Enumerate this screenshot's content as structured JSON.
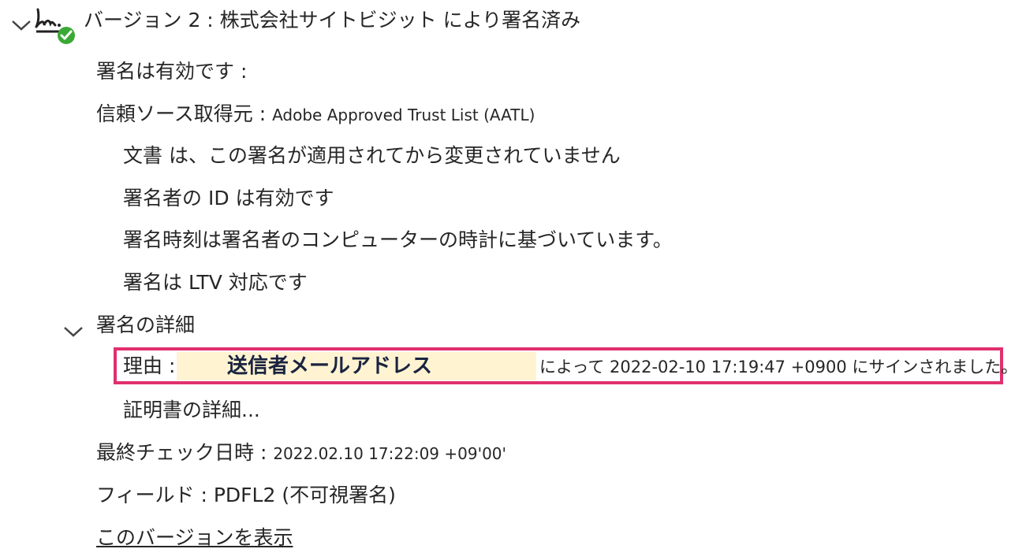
{
  "header": {
    "title": "バージョン 2 : 株式会社サイトビジット により署名済み",
    "expand_icon": "chevron-down-icon",
    "signature_icon": "signature-valid-icon",
    "status_color": "#3aa935"
  },
  "status": {
    "valid": "署名は有効です :",
    "trust_source_prefix": "信頼ソース取得元 : ",
    "trust_source_value": "Adobe Approved Trust List (AATL)",
    "items": [
      "文書 は、この署名が適用されてから変更されていません",
      "署名者の ID は有効です",
      "署名時刻は署名者のコンピューターの時計に基づいています。",
      "署名は LTV 対応です"
    ]
  },
  "details": {
    "label": "署名の詳細",
    "reason_label": "理由 :",
    "reason_value": "送信者メールアドレス",
    "reason_suffix": "によって 2022-02-10 17:19:47 +0900 にサインされました。",
    "certificate_link": "証明書の詳細...",
    "highlight_color": "#e0306e",
    "fill_color": "#fff3d2"
  },
  "footer": {
    "last_checked_label": "最終チェック日時 : ",
    "last_checked_value": "2022.02.10 17:22:09 +09'00'",
    "field_label": "フィールド : ",
    "field_value": "PDFL2 (不可視署名)",
    "view_version_link": "このバージョンを表示"
  }
}
